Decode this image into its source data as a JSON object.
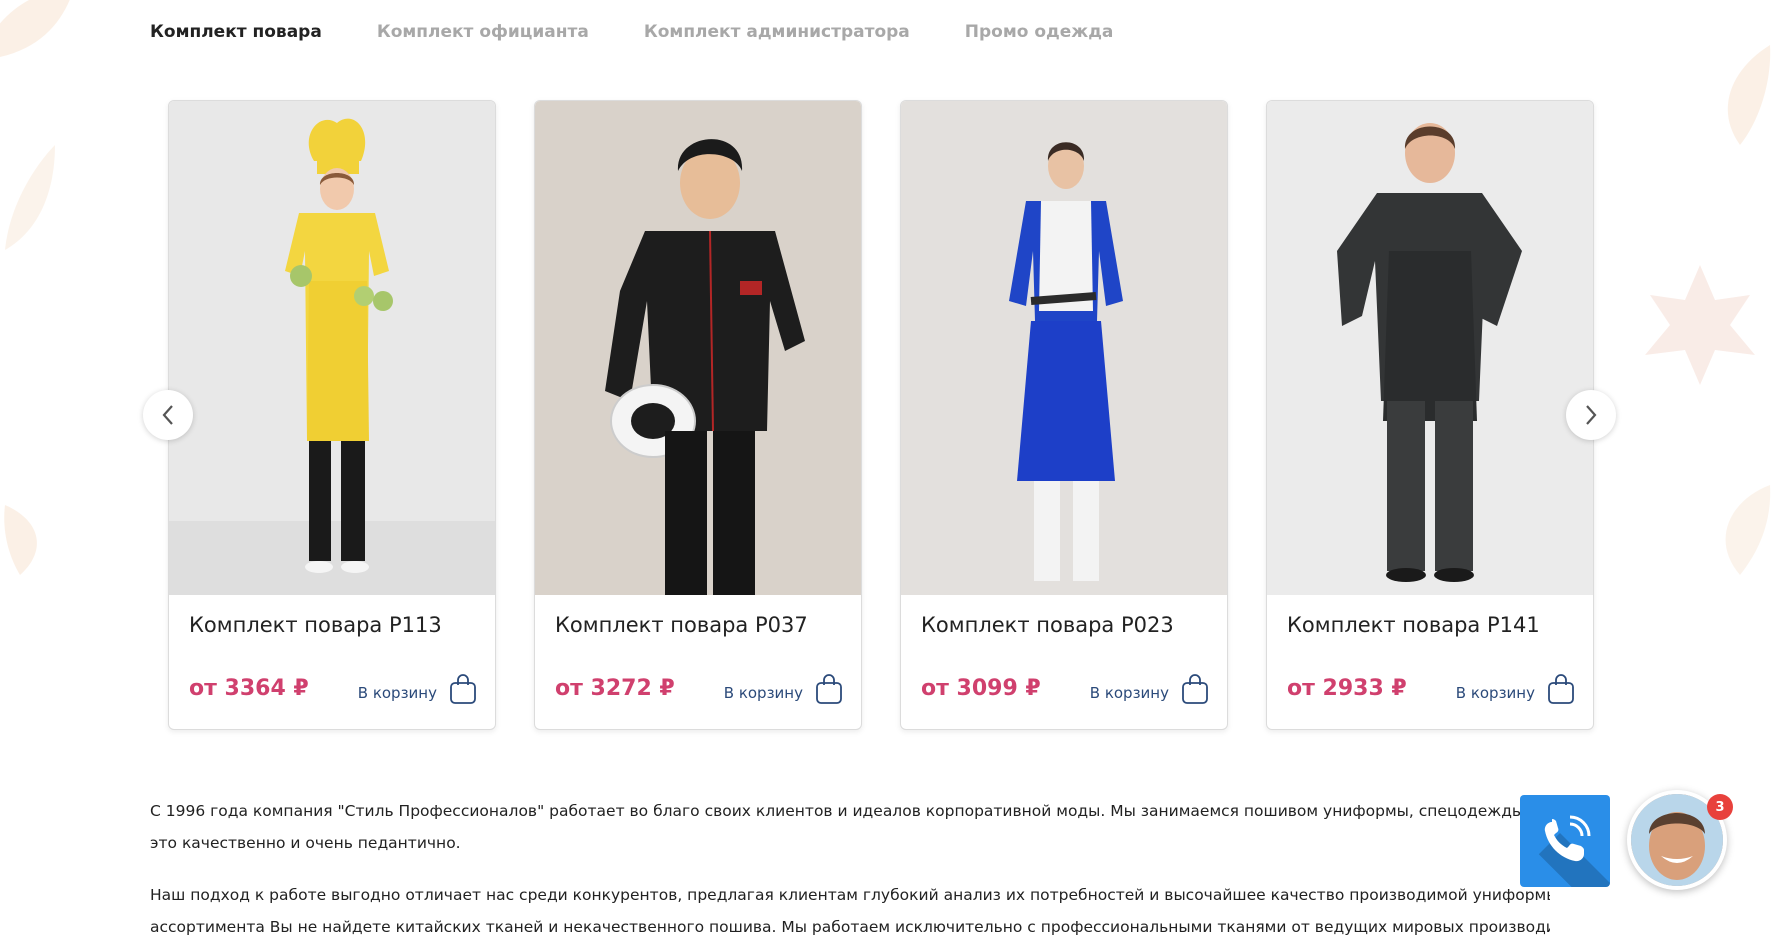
{
  "tabs": [
    {
      "label": "Комплект повара",
      "active": true
    },
    {
      "label": "Комплект официанта",
      "active": false
    },
    {
      "label": "Комплект администратора",
      "active": false
    },
    {
      "label": "Промо одежда",
      "active": false
    }
  ],
  "products": [
    {
      "title": "Комплект повара Р113",
      "price": "от 3364 ₽",
      "cart_label": "В корзину",
      "outfit": "yellow chef uniform"
    },
    {
      "title": "Комплект повара Р037",
      "price": "от 3272 ₽",
      "cart_label": "В корзину",
      "outfit": "black chef jacket"
    },
    {
      "title": "Комплект повара Р023",
      "price": "от 3099 ₽",
      "cart_label": "В корзину",
      "outfit": "blue and white chef uniform"
    },
    {
      "title": "Комплект повара Р141",
      "price": "от 2933 ₽",
      "cart_label": "В корзину",
      "outfit": "grey denim chef jacket"
    }
  ],
  "icons": {
    "prev": "chevron-left-icon",
    "next": "chevron-right-icon",
    "cart": "shopping-bag-icon",
    "call": "phone-icon"
  },
  "description": {
    "p1_line1": "С 1996 года компания \"Стиль Профессионалов\" работает во благо своих клиентов и идеалов корпоративной моды. Мы занимаемся пошивом униформы, спецодежды и текстиля",
    "p1_line2": "это качественно и очень педантично.",
    "p2_line1": "Наш подход к работе выгодно отличает нас среди конкурентов, предлагая клиентам глубокий анализ их потребностей и высочайшее качество производимой униформы. Среди нашего",
    "p2_line2": "ассортимента Вы не найдете китайских тканей и некачественного пошива. Мы работаем исключительно с профессиональными тканями от ведущих мировых производителей. Среди сотен"
  },
  "widget": {
    "badge_count": "3"
  },
  "colors": {
    "price": "#d0406e",
    "cart_text": "#2b4a7a",
    "call_button": "#2a8ee8",
    "badge": "#e8413c",
    "tab_active": "#222222",
    "tab_inactive": "#a8a8a8"
  }
}
